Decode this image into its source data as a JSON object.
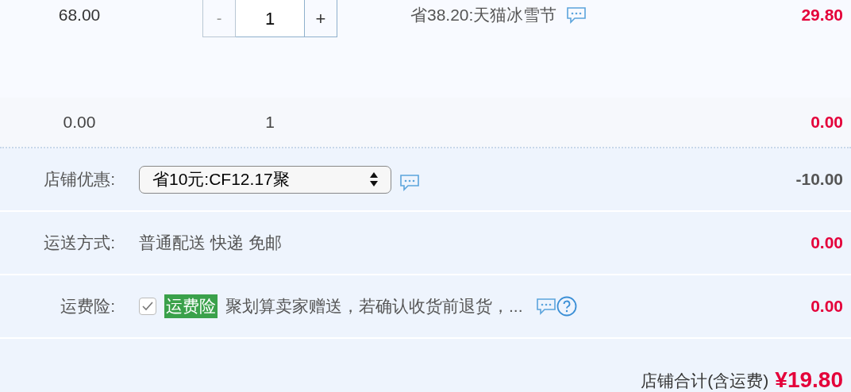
{
  "item": {
    "price": "68.00",
    "quantity": {
      "minus": "-",
      "value": "1",
      "plus": "+"
    },
    "promotion": "省38.20:天猫冰雪节",
    "subtotal": "29.80"
  },
  "gift_row": {
    "price": "0.00",
    "quantity": "1",
    "subtotal": "0.00"
  },
  "store_discount": {
    "label": "店铺优惠:",
    "selected_option": "省10元:CF12.17聚",
    "amount": "-10.00"
  },
  "shipping": {
    "label": "运送方式:",
    "method": "普通配送 快递 免邮",
    "amount": "0.00"
  },
  "insurance": {
    "label": "运费险:",
    "checked": true,
    "tag": "运费险",
    "description": "聚划算卖家赠送，若确认收货前退货，...",
    "amount": "0.00"
  },
  "total": {
    "label": "店铺合计(含运费)",
    "amount": "¥19.80"
  }
}
